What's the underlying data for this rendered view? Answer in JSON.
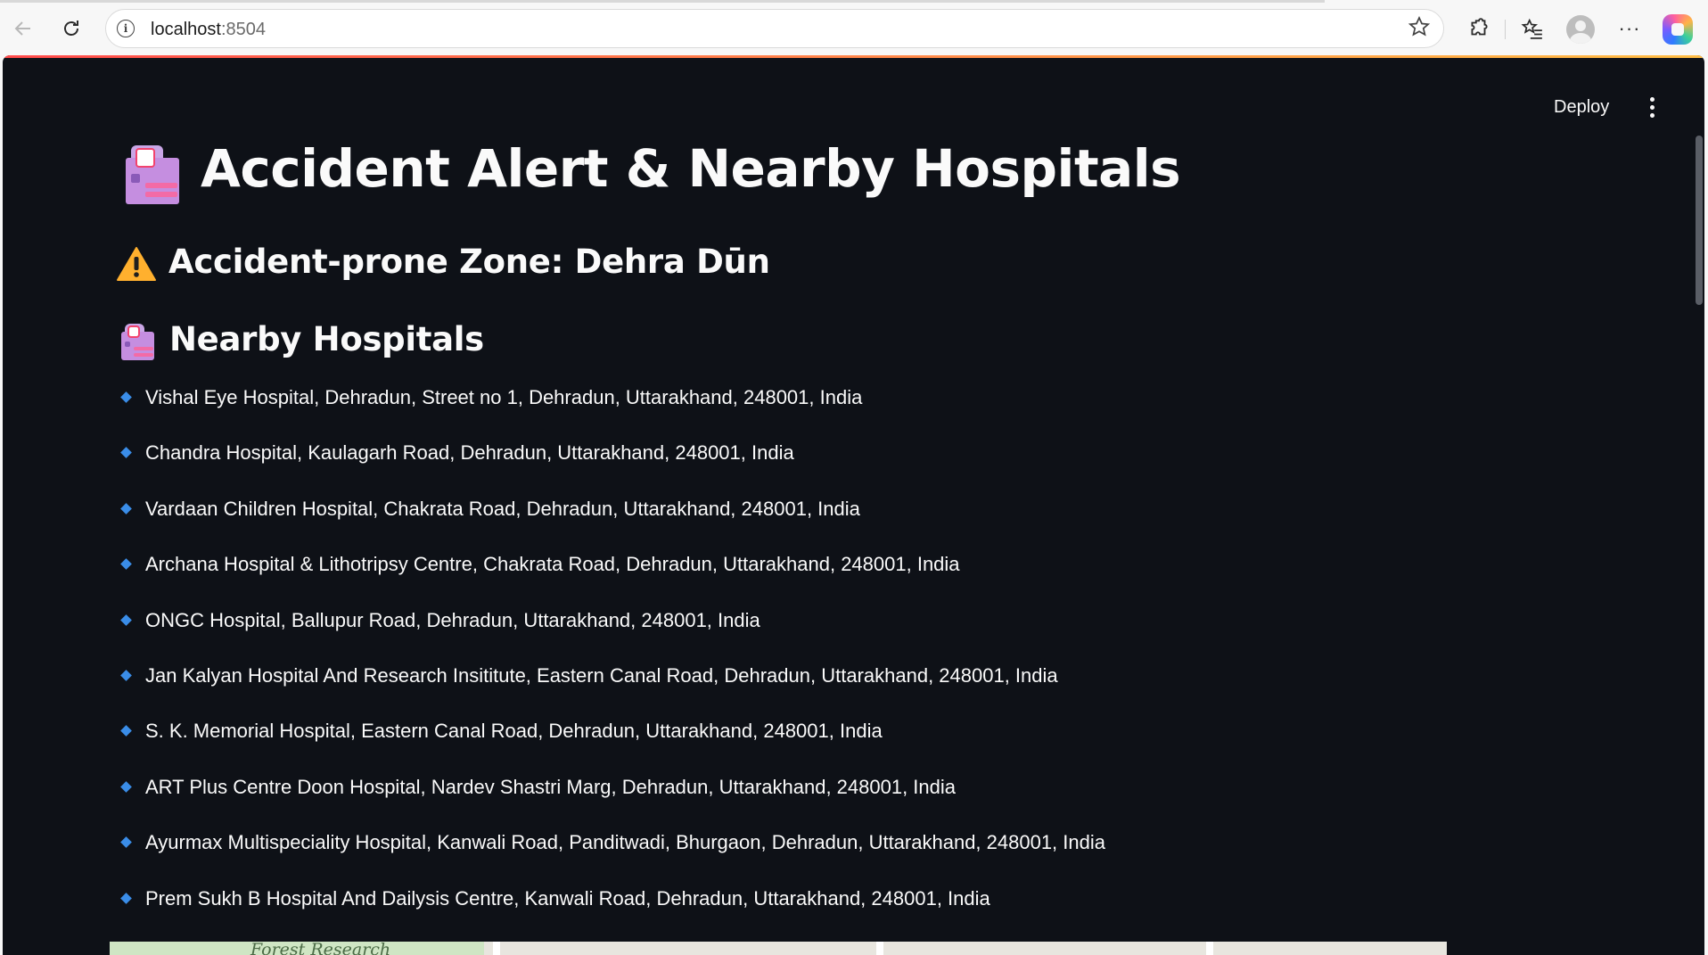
{
  "browser": {
    "url_host": "localhost",
    "url_port": ":8504",
    "icons": {
      "back": "back-arrow-icon",
      "reload": "reload-icon",
      "info": "site-info-icon",
      "favorite": "star-icon",
      "extensions": "puzzle-icon",
      "favorites_bar": "favorites-icon",
      "profile": "profile-icon",
      "menu": "more-icon",
      "copilot": "copilot-icon"
    }
  },
  "app": {
    "toolbar": {
      "deploy_label": "Deploy"
    },
    "title": "Accident Alert & Nearby Hospitals",
    "zone_heading": "Accident-prone Zone: Dehra Dūn",
    "hospitals_heading": "Nearby Hospitals",
    "hospitals": [
      "Vishal Eye Hospital, Dehradun, Street no 1, Dehradun, Uttarakhand, 248001, India",
      "Chandra Hospital, Kaulagarh Road, Dehradun, Uttarakhand, 248001, India",
      "Vardaan Children Hospital, Chakrata Road, Dehradun, Uttarakhand, 248001, India",
      "Archana Hospital & Lithotripsy Centre, Chakrata Road, Dehradun, Uttarakhand, 248001, India",
      "ONGC Hospital, Ballupur Road, Dehradun, Uttarakhand, 248001, India",
      "Jan Kalyan Hospital And Research Insititute, Eastern Canal Road, Dehradun, Uttarakhand, 248001, India",
      "S. K. Memorial Hospital, Eastern Canal Road, Dehradun, Uttarakhand, 248001, India",
      "ART Plus Centre Doon Hospital, Nardev Shastri Marg, Dehradun, Uttarakhand, 248001, India",
      "Ayurmax Multispeciality Hospital, Kanwali Road, Panditwadi, Bhurgaon, Dehradun, Uttarakhand, 248001, India",
      "Prem Sukh B Hospital And Dailysis Centre, Kanwali Road, Dehradun, Uttarakhand, 248001, India"
    ],
    "map": {
      "visible_label": "Forest Research"
    },
    "colors": {
      "background": "#0e1117",
      "text": "#fafafa",
      "bullet": "#3a8de8",
      "accent_start": "#ff4b4b",
      "accent_end": "#ffbd45"
    }
  }
}
